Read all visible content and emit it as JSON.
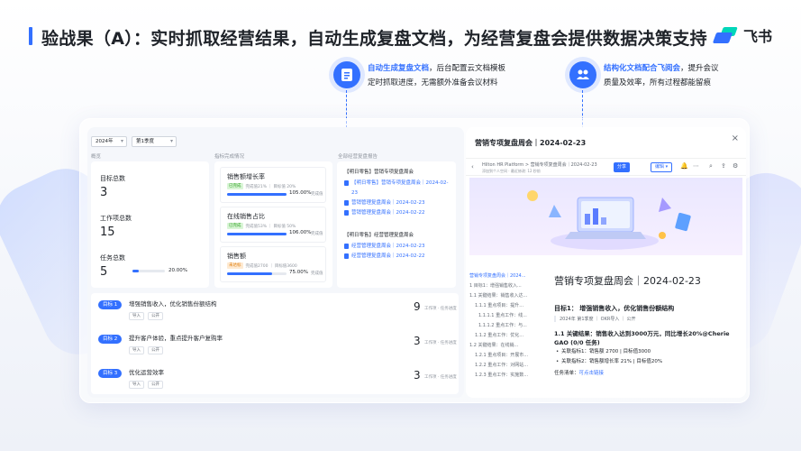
{
  "header": {
    "title": "验战果（A）：实时抓取经营结果，自动生成复盘文档，为经营复盘会提供数据决策支持",
    "brand_name": "飞书",
    "accent_color": "#3370ff"
  },
  "callouts": [
    {
      "icon": "document-icon",
      "highlight": "自动生成复盘文档",
      "line1_rest": "，后台配置云文档模板",
      "line2": "定时抓取进度，无需额外准备会议材料"
    },
    {
      "icon": "meeting-icon",
      "highlight": "结构化文档配合飞阅会",
      "line1_rest": "，提升会议",
      "line2": "质量及效率，所有过程都能留痕"
    }
  ],
  "dashboard": {
    "year_select": "2024年",
    "quarter_select": "第1季度",
    "sections": {
      "overview": "概览",
      "indicators": "指标完成情况",
      "docs": "全部经营复盘报告"
    },
    "overview": [
      {
        "label": "目标总数",
        "value": "3"
      },
      {
        "label": "工作项总数",
        "value": "15"
      },
      {
        "label": "任务总数",
        "value": "5",
        "progress_pct": "20.00%",
        "progress": 0.2
      }
    ],
    "kpis": [
      {
        "title": "销售额增长率",
        "tag": "已完成",
        "tag_color": "green",
        "sub": "完成值21% ｜ 目标值 20%",
        "pct": "105.00%",
        "progress": 1.0,
        "done": "完成值"
      },
      {
        "title": "在线销售占比",
        "tag": "已完成",
        "tag_color": "green",
        "sub": "完成值53% ｜ 目标值 50%",
        "pct": "106.00%",
        "progress": 1.0,
        "done": "完成值"
      },
      {
        "title": "销售额",
        "tag": "未达标",
        "tag_color": "orange",
        "sub": "完成值2700 ｜ 目标值3600",
        "pct": "75.00%",
        "progress": 0.75,
        "done": "完成值"
      }
    ],
    "doc_groups": [
      {
        "title": "【明日零售】营销专项复盘周会",
        "links": [
          "【明日零售】营销专项复盘周会｜2024-02-23",
          "营销管理复盘周会｜2024-02-23",
          "营销管理复盘周会｜2024-02-22"
        ]
      },
      {
        "title": "【明日零售】经营管理复盘周会",
        "links": [
          "经营管理复盘周会｜2024-02-23",
          "经营管理复盘周会｜2024-02-22"
        ]
      }
    ],
    "goals": [
      {
        "pill": "目标 1",
        "text": "增强销售收入，优化销售份额结构",
        "count": "9",
        "count_label": "工作项 · 任务进度",
        "chips": [
          "导入",
          "公开"
        ]
      },
      {
        "pill": "目标 2",
        "text": "提升客户体验，重点提升客户复购率",
        "count": "3",
        "count_label": "工作项 · 任务进度",
        "chips": [
          "导入",
          "公开"
        ]
      },
      {
        "pill": "目标 3",
        "text": "优化运营效率",
        "count": "3",
        "count_label": "工作项 · 任务进度",
        "chips": [
          "导入",
          "公开"
        ]
      }
    ]
  },
  "docwin": {
    "title": "营销专项复盘周会｜2024-02-23",
    "close": "×",
    "breadcrumb": "Hilton HR Platform  >  营销专项复盘周会｜2024-02-23",
    "sub": "添加到个人空间 · 最近修改: 12 秒前",
    "share": "分享",
    "edit": "编辑 ▾",
    "toc": [
      {
        "text": "营销专项复盘周会｜2024...",
        "active": true
      },
      {
        "text": "1 目标1：增强销售收入..."
      },
      {
        "text": "1.1 关键结果：销售收入达..."
      },
      {
        "text": "1.1.1 重点项目：提升..."
      },
      {
        "text": "1.1.1.1 重点工作：线..."
      },
      {
        "text": "1.1.1.2 重点工作：与..."
      },
      {
        "text": "1.1.2 重点工作：优化..."
      },
      {
        "text": "1.2 关键结果：在线销..."
      },
      {
        "text": "1.2.1 重点项目：开展市..."
      },
      {
        "text": "1.2.2 重点工作：对网站..."
      },
      {
        "text": "1.2.3 重点工作：实施数..."
      }
    ],
    "body": {
      "h1": "营销专项复盘周会｜2024-02-23",
      "h2": "目标1：  增强销售收入，优化销售份额结构",
      "meta": "2024年 第1季度 ｜ OKR导入 ｜ 公开",
      "kr": "1.1 关键结果：销售收入达到3000万元，同比增长20%@Cherie GAO (0/0 任务)",
      "bullets": [
        "关联指标1：销售额 2700 | 目标值3000",
        "关联指标2：销售额增长率 21% | 目标值20%"
      ],
      "task_label": "任务清单：",
      "task_link": "可点击链接"
    }
  }
}
